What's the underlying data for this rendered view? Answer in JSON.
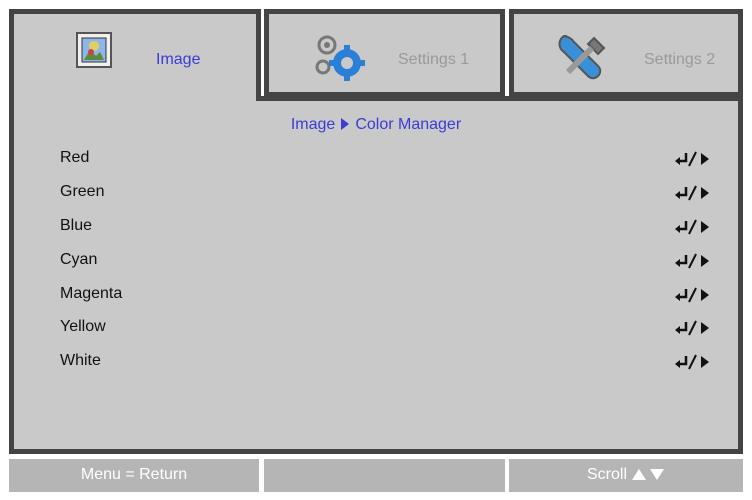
{
  "tabs": [
    {
      "label": "Image",
      "icon": "image-icon",
      "active": true
    },
    {
      "label": "Settings 1",
      "icon": "gears-icon",
      "active": false
    },
    {
      "label": "Settings 2",
      "icon": "tools-icon",
      "active": false
    }
  ],
  "breadcrumb": {
    "parent": "Image",
    "current": "Color Manager"
  },
  "menu_items": [
    {
      "label": "Red"
    },
    {
      "label": "Green"
    },
    {
      "label": "Blue"
    },
    {
      "label": "Cyan"
    },
    {
      "label": "Magenta"
    },
    {
      "label": "Yellow"
    },
    {
      "label": "White"
    }
  ],
  "footer": {
    "left": "Menu = Return",
    "middle": "",
    "right": "Scroll"
  },
  "colors": {
    "accent": "#3b3bd6",
    "panel": "#c9c9c9",
    "border": "#444444",
    "footer": "#b5b5b5"
  }
}
